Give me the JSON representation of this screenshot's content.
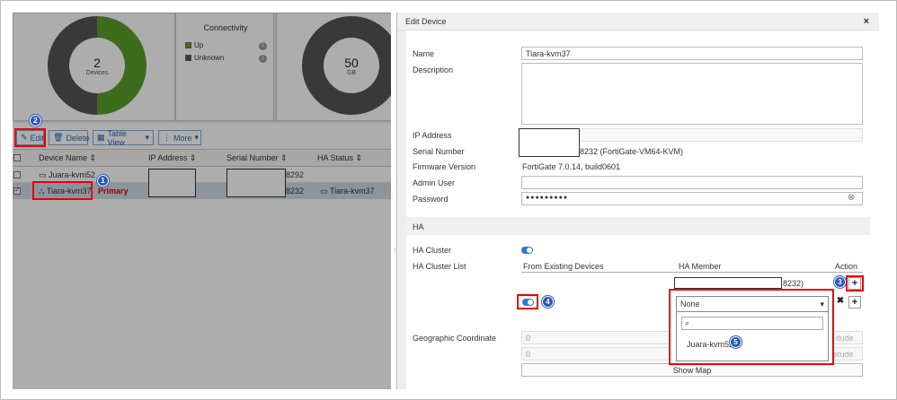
{
  "cards": {
    "devices": {
      "count": "2",
      "label": "Devices"
    },
    "connectivity": {
      "title": "Connectivity",
      "legend": [
        {
          "label": "Up",
          "count": "1",
          "color": "#5aa02c"
        },
        {
          "label": "Unknown",
          "count": "1",
          "color": "#555555"
        }
      ]
    },
    "storage": {
      "count": "50",
      "label": "GB"
    }
  },
  "toolbar": {
    "edit": "Edit",
    "delete": "Delete",
    "table_view": "Table View",
    "more": "More"
  },
  "table": {
    "headers": [
      "Device Name",
      "IP Address",
      "Serial Number",
      "HA Status"
    ],
    "rows": [
      {
        "name": "Juara-kvm52",
        "serial_suffix": "8292",
        "ha": ""
      },
      {
        "name": "Tiara-kvm37",
        "serial_suffix": "8232",
        "ha": "Tiara-kvm37",
        "tag": "Primary"
      }
    ]
  },
  "badges": [
    "1",
    "2",
    "3",
    "4",
    "5"
  ],
  "modal": {
    "title": "Edit Device",
    "close": "×",
    "name_label": "Name",
    "name_value": "Tiara-kvm37",
    "description_label": "Description",
    "ip_label": "IP Address",
    "serial_label": "Serial Number",
    "serial_value": "8232 (FortiGate-VM64-KVM)",
    "firmware_label": "Firmware Version",
    "firmware_value": "FortiGate 7.0.14, build0601",
    "admin_label": "Admin User",
    "password_label": "Password",
    "password_value": "●●●●●●●●●",
    "ha_section": "HA",
    "ha_cluster_label": "HA Cluster",
    "ha_list_label": "HA Cluster List",
    "col_from": "From Existing Devices",
    "col_member": "HA Member",
    "col_action": "Action",
    "member_suffix": "8232)",
    "select_value": "None",
    "dropdown_option": "Juara-kvm52",
    "geo_label": "Geographic Coordinate",
    "lat_value": "0",
    "lon_value": "0",
    "lat_hint": "itude",
    "lon_hint": "gitude",
    "show_map": "Show Map"
  }
}
